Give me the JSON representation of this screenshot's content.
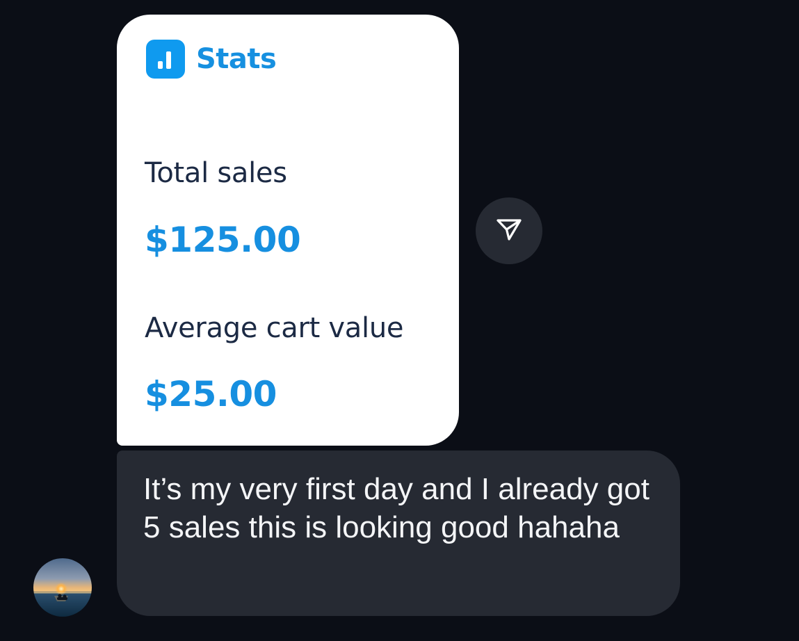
{
  "shared_card": {
    "header_icon": "bar-chart-icon",
    "header_title": "Stats",
    "metrics": [
      {
        "label": "Total sales",
        "value": "$125.00"
      },
      {
        "label": "Average cart value",
        "value": "$25.00"
      }
    ],
    "colors": {
      "accent": "#168fe0",
      "label_text": "#1c2a44",
      "background": "#ffffff"
    }
  },
  "share_button": {
    "icon": "send-icon"
  },
  "message": {
    "text": "It’s my very first day and I already got 5 sales this is looking good hahaha"
  },
  "sender": {
    "avatar_icon": "sunset-avatar"
  },
  "theme": {
    "background": "#0b0e16",
    "bubble": "#262a33",
    "message_text": "#f4f5f7"
  }
}
